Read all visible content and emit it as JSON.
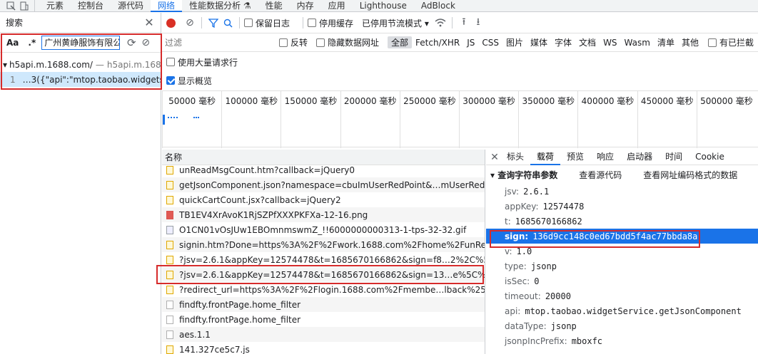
{
  "top_tabs": [
    "元素",
    "控制台",
    "源代码",
    "网络",
    "性能数据分析 ⚗",
    "性能",
    "内存",
    "应用",
    "Lighthouse",
    "AdBlock"
  ],
  "active_top_tab": "网络",
  "search": {
    "title": "搜索",
    "case_btn": "Aa",
    "regex_btn": ".*",
    "query": "广州黄峥服饰有限公",
    "results": [
      {
        "host": "h5api.m.1688.com/",
        "sep": "—",
        "path": "h5api.m.168..."
      },
      {
        "num": "1",
        "text": "…3({\"api\":\"mtop.taobao.widgets…"
      }
    ]
  },
  "toolbar": {
    "preserve_log": "保留日志",
    "disable_cache": "停用缓存",
    "throttle": "已停用节流模式"
  },
  "filter": {
    "placeholder": "过滤",
    "invert": "反转",
    "hide_data_urls": "隐藏数据网址",
    "types": [
      "全部",
      "Fetch/XHR",
      "JS",
      "CSS",
      "图片",
      "媒体",
      "字体",
      "文档",
      "WS",
      "Wasm",
      "清单",
      "其他"
    ],
    "blocked": "有已拦截"
  },
  "options": {
    "big_rows": "使用大量请求行",
    "overview": "显示概览"
  },
  "timeline_ticks": [
    "50000 毫秒",
    "100000 毫秒",
    "150000 毫秒",
    "200000 毫秒",
    "250000 毫秒",
    "300000 毫秒",
    "350000 毫秒",
    "400000 毫秒",
    "450000 毫秒",
    "500000 毫秒"
  ],
  "requests": {
    "header": "名称",
    "rows": [
      {
        "type": "js",
        "name": "unReadMsgCount.htm?callback=jQuery0"
      },
      {
        "type": "js",
        "name": "getJsonComponent.json?namespace=cbuImUserRedPoint&…mUserRedPoi…"
      },
      {
        "type": "js",
        "name": "quickCartCount.jsx?callback=jQuery2"
      },
      {
        "type": "img",
        "name": "TB1EV4XrAvoK1RjSZPfXXXPKFXa-12-16.png"
      },
      {
        "type": "gif",
        "name": "O1CN01vOsJUw1EBOmnmswmZ_!!6000000000313-1-tps-32-32.gif"
      },
      {
        "type": "js",
        "name": "signin.htm?Done=https%3A%2F%2Fwork.1688.com%2Fhome%2FunRead…"
      },
      {
        "type": "js",
        "name": "?jsv=2.6.1&appKey=12574478&t=1685670166862&sign=f8…2%2C%5C%2…"
      },
      {
        "type": "js",
        "name": "?jsv=2.6.1&appKey=12574478&t=1685670166862&sign=13…e%5C%22%3…"
      },
      {
        "type": "js",
        "name": "?redirect_url=https%3A%2F%2Flogin.1688.com%2Fmembe…lback%2525…"
      },
      {
        "type": "doc",
        "name": "findfty.frontPage.home_filter"
      },
      {
        "type": "doc",
        "name": "findfty.frontPage.home_filter"
      },
      {
        "type": "doc",
        "name": "aes.1.1"
      },
      {
        "type": "js",
        "name": "141.327ce5c7.js"
      }
    ]
  },
  "detail": {
    "tabs": [
      "标头",
      "载荷",
      "预览",
      "响应",
      "启动器",
      "时间",
      "Cookie"
    ],
    "active": "载荷",
    "section": "▾ 查询字符串参数",
    "view_source": "查看源代码",
    "view_encoded": "查看网址编码格式的数据",
    "params": [
      {
        "k": "jsv:",
        "v": "2.6.1"
      },
      {
        "k": "appKey:",
        "v": "12574478"
      },
      {
        "k": "t:",
        "v": "1685670166862"
      },
      {
        "k": "sign:",
        "v": "136d9cc148c0ed67bdd5f4ac77bbda8a"
      },
      {
        "k": "v:",
        "v": "1.0"
      },
      {
        "k": "type:",
        "v": "jsonp"
      },
      {
        "k": "isSec:",
        "v": "0"
      },
      {
        "k": "timeout:",
        "v": "20000"
      },
      {
        "k": "api:",
        "v": "mtop.taobao.widgetService.getJsonComponent"
      },
      {
        "k": "dataType:",
        "v": "jsonp"
      },
      {
        "k": "jsonpIncPrefix:",
        "v": "mboxfc"
      }
    ]
  }
}
